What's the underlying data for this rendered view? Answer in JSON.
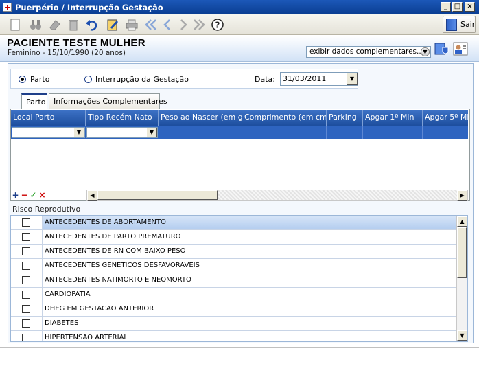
{
  "window": {
    "title": "Puerpério / Interrupção Gestação"
  },
  "toolbar": {
    "exit_label": "Sair"
  },
  "patient": {
    "name": "PACIENTE TESTE MULHER",
    "info": "Feminino - 15/10/1990 (20 anos)",
    "extra_dropdown": "exibir dados complementares..."
  },
  "form": {
    "option_parto": "Parto",
    "option_interrupcao": "Interrupção da Gestação",
    "date_label": "Data:",
    "date_value": "31/03/2011"
  },
  "tabs": [
    {
      "label": "Parto"
    },
    {
      "label": "Informações Complementares"
    }
  ],
  "grid": {
    "columns": [
      "Local Parto",
      "Tipo Recém Nato",
      "Peso ao Nascer (em g",
      "Comprimento (em cm",
      "Parking",
      "Apgar 1º Min",
      "Apgar 5º Mi"
    ]
  },
  "risk": {
    "label": "Risco Reprodutivo",
    "items": [
      "ANTECEDENTES DE ABORTAMENTO",
      "ANTECEDENTES DE PARTO PREMATURO",
      "ANTECEDENTES DE RN COM BAIXO PESO",
      "ANTECEDENTES GENETICOS DESFAVORAVEIS",
      "ANTECEDENTES NATIMORTO E NEOMORTO",
      "CARDIOPATIA",
      "DHEG EM GESTACAO ANTERIOR",
      "DIABETES",
      "HIPERTENSAO ARTERIAL"
    ]
  },
  "colors": {
    "title_bar": "#0a3d91",
    "grid_header": "#2e64c0",
    "selection": "#b3cdef"
  }
}
